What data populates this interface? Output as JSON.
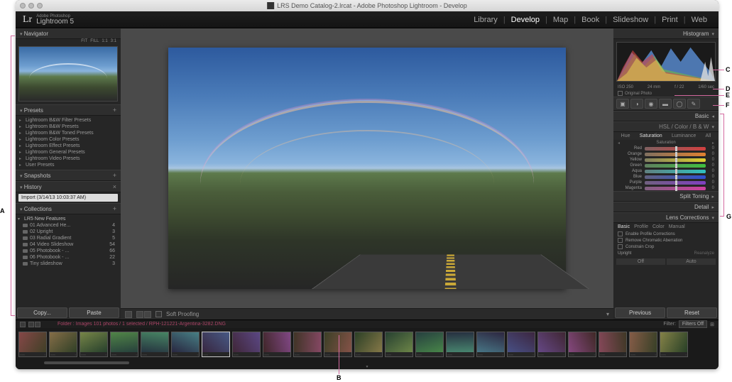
{
  "window_title": "LRS Demo Catalog-2.lrcat - Adobe Photoshop Lightroom - Develop",
  "logo_brand": "Adobe Photoshop",
  "logo_name": "Lightroom 5",
  "modules": [
    "Library",
    "Develop",
    "Map",
    "Book",
    "Slideshow",
    "Print",
    "Web"
  ],
  "active_module": "Develop",
  "left": {
    "navigator": {
      "title": "Navigator",
      "opts": [
        "FIT",
        "FILL",
        "1:1",
        "3:1"
      ]
    },
    "presets": {
      "title": "Presets",
      "items": [
        "Lightroom B&W Filter Presets",
        "Lightroom B&W Presets",
        "Lightroom B&W Toned Presets",
        "Lightroom Color Presets",
        "Lightroom Effect Presets",
        "Lightroom General Presets",
        "Lightroom Video Presets",
        "User Presets"
      ]
    },
    "snapshots": {
      "title": "Snapshots"
    },
    "history": {
      "title": "History",
      "item": "Import (3/14/13 10:03:37 AM)"
    },
    "collections": {
      "title": "Collections",
      "folder": "LR5 New Features",
      "items": [
        {
          "label": "01 Advanced He...",
          "count": "4"
        },
        {
          "label": "02 Upright",
          "count": "3"
        },
        {
          "label": "03 Radial Gradient",
          "count": "5"
        },
        {
          "label": "04 Video Slideshow",
          "count": "54"
        },
        {
          "label": "05 Photobook - ...",
          "count": "66"
        },
        {
          "label": "06 Photobook - ...",
          "count": "22"
        },
        {
          "label": "Tiny slideshow",
          "count": "3"
        }
      ]
    },
    "copy_btn": "Copy...",
    "paste_btn": "Paste"
  },
  "toolbar": {
    "softproof": "Soft Proofing"
  },
  "right": {
    "histogram": {
      "title": "Histogram",
      "meta": [
        "ISO 250",
        "24 mm",
        "f / 22",
        "1/60 sec"
      ],
      "orig": "Original Photo"
    },
    "basic": "Basic",
    "hsl": {
      "title": "HSL  /  Color  /  B & W",
      "tabs": [
        "Hue",
        "Saturation",
        "Luminance",
        "All"
      ],
      "active": "Saturation",
      "header": "Saturation",
      "sliders": [
        {
          "label": "Red",
          "grad": "linear-gradient(to right,#806060,#d04040)"
        },
        {
          "label": "Orange",
          "grad": "linear-gradient(to right,#807060,#e08030)"
        },
        {
          "label": "Yellow",
          "grad": "linear-gradient(to right,#808060,#e0d030)"
        },
        {
          "label": "Green",
          "grad": "linear-gradient(to right,#608060,#40c040)"
        },
        {
          "label": "Aqua",
          "grad": "linear-gradient(to right,#608080,#30c0c0)"
        },
        {
          "label": "Blue",
          "grad": "linear-gradient(to right,#606080,#3050d0)"
        },
        {
          "label": "Purple",
          "grad": "linear-gradient(to right,#706080,#8040c0)"
        },
        {
          "label": "Magenta",
          "grad": "linear-gradient(to right,#806080,#d040a0)"
        }
      ]
    },
    "split": "Split Toning",
    "detail": "Detail",
    "lens": {
      "title": "Lens Corrections",
      "tabs": [
        "Basic",
        "Profile",
        "Color",
        "Manual"
      ],
      "checks": [
        "Enable Profile Corrections",
        "Remove Chromatic Aberration",
        "Constrain Crop"
      ],
      "upright": "Upright",
      "reanalyze": "Reanalyze",
      "off": "Off",
      "auto": "Auto"
    },
    "prev_btn": "Previous",
    "reset_btn": "Reset"
  },
  "strip": {
    "path": "Folder : Images      101 photos / 1 selected / RPH-121221-Argentina-3282.DNG",
    "filter": "Filter:",
    "filters_off": "Filters Off"
  },
  "callouts": {
    "A": "A",
    "B": "B",
    "C": "C",
    "D": "D",
    "E": "E",
    "F": "F",
    "G": "G"
  }
}
